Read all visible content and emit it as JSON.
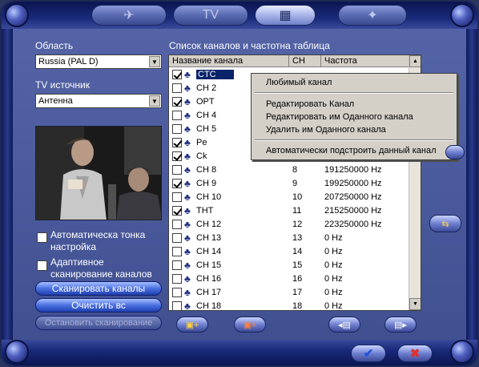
{
  "top_tabs": [
    {
      "icon": "dish-icon",
      "glyph": "✈"
    },
    {
      "icon": "tv-icon",
      "glyph": "TV"
    },
    {
      "icon": "film-icon",
      "glyph": "▦"
    },
    {
      "icon": "star-icon",
      "glyph": "✦"
    }
  ],
  "region": {
    "label": "Область",
    "value": "Russia (PAL D)"
  },
  "tv_source": {
    "label": "TV источник",
    "value": "Антенна"
  },
  "options": {
    "auto_tune_label": "Автоматическа тонка настройка",
    "adaptive_scan_label": "Адаптивное сканирование каналов"
  },
  "buttons": {
    "scan": "Сканировать каналы",
    "clear": "Очистить вс",
    "stop": "Остановить сканирование"
  },
  "channel_table": {
    "title": "Список каналов и частотна таблица",
    "columns": [
      "Название канала",
      "CH",
      "Частота"
    ],
    "rows": [
      {
        "checked": true,
        "name": "CTC",
        "ch": "",
        "freq": "",
        "selected": true
      },
      {
        "checked": false,
        "name": "CH 2",
        "ch": "",
        "freq": ""
      },
      {
        "checked": true,
        "name": "OPT",
        "ch": "",
        "freq": ""
      },
      {
        "checked": false,
        "name": "CH 4",
        "ch": "",
        "freq": ""
      },
      {
        "checked": false,
        "name": "CH 5",
        "ch": "",
        "freq": ""
      },
      {
        "checked": true,
        "name": "Pe",
        "ch": "",
        "freq": ""
      },
      {
        "checked": true,
        "name": "Ck",
        "ch": "",
        "freq": ""
      },
      {
        "checked": false,
        "name": "CH 8",
        "ch": "8",
        "freq": "191250000 Hz"
      },
      {
        "checked": true,
        "name": "CH 9",
        "ch": "9",
        "freq": "199250000 Hz"
      },
      {
        "checked": false,
        "name": "CH 10",
        "ch": "10",
        "freq": "207250000 Hz"
      },
      {
        "checked": true,
        "name": "THT",
        "ch": "11",
        "freq": "215250000 Hz"
      },
      {
        "checked": false,
        "name": "CH 12",
        "ch": "12",
        "freq": "223250000 Hz"
      },
      {
        "checked": false,
        "name": "CH 13",
        "ch": "13",
        "freq": "0 Hz"
      },
      {
        "checked": false,
        "name": "CH 14",
        "ch": "14",
        "freq": "0 Hz"
      },
      {
        "checked": false,
        "name": "CH 15",
        "ch": "15",
        "freq": "0 Hz"
      },
      {
        "checked": false,
        "name": "CH 16",
        "ch": "16",
        "freq": "0 Hz"
      },
      {
        "checked": false,
        "name": "CH 17",
        "ch": "17",
        "freq": "0 Hz"
      },
      {
        "checked": false,
        "name": "CH 18",
        "ch": "18",
        "freq": "0 Hz"
      }
    ]
  },
  "context_menu": {
    "items": [
      "Любимый канал",
      "Редактировать Канал",
      "Редактировать им Оданного канала",
      "Удалить им Оданного канала",
      "Автоматически подстроить данный канал"
    ]
  },
  "colors": {
    "frame": "#4a5a9c",
    "selection": "#0a246a",
    "pill_button": "#4a70e0"
  }
}
